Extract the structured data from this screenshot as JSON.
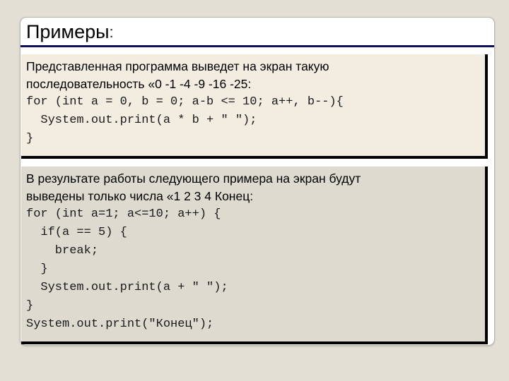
{
  "slide": {
    "title": "Примеры",
    "title_colon": ":",
    "accent_color": "#10105a",
    "background_color": "#e3dfd5",
    "card_color": "#ffffff"
  },
  "blocks": [
    {
      "name": "example-block-1",
      "background_color": "#f2ece1",
      "prose": [
        "Представленная программа выведет на экран такую",
        "последовательность «0 -1 -4 -9 -16 -25:"
      ],
      "code": [
        "for (int a = 0, b = 0; a-b <= 10; a++, b--){",
        "  System.out.print(a * b + \" \");",
        "}"
      ]
    },
    {
      "name": "example-block-2",
      "background_color": "#dedad0",
      "prose": [
        "В результате работы следующего примера на экран будут",
        "выведены только числа «1 2 3 4 Конец:"
      ],
      "code": [
        "for (int a=1; a<=10; a++) {",
        "  if(a == 5) {",
        "    break;",
        "  }",
        "  System.out.print(a + \" \");",
        "}",
        "System.out.print(\"Конец\");"
      ]
    }
  ]
}
